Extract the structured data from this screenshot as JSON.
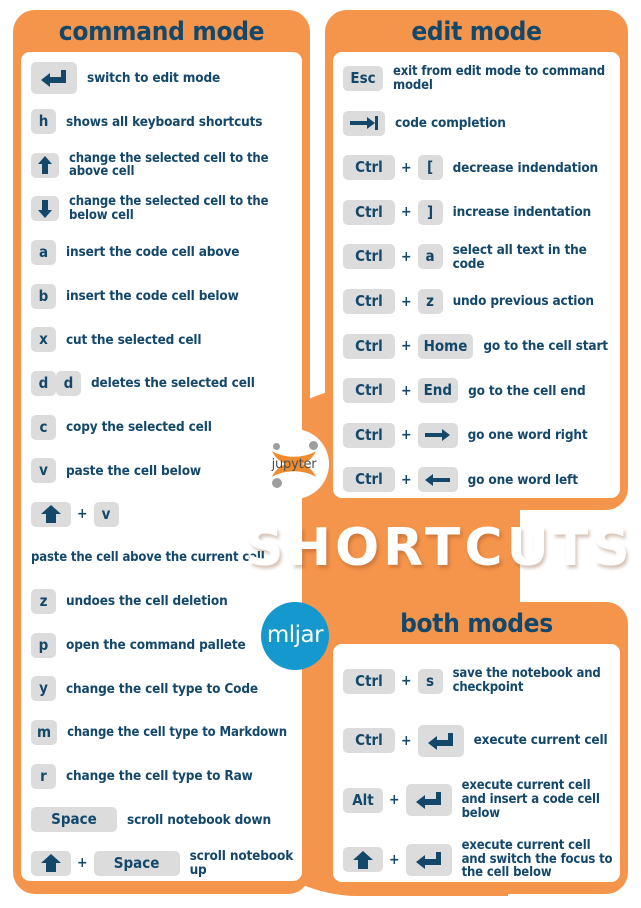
{
  "title": "SHORTCUTS",
  "colors": {
    "orange": "#F5944B",
    "navy": "#13486B",
    "key_gray": "#DCDCDC",
    "mljar_blue": "#1498CD",
    "white": "#FFFFFF"
  },
  "logos": {
    "jupyter": "jupyter",
    "mljar": "mljar"
  },
  "panels": {
    "command": {
      "title": "command mode",
      "rows": [
        {
          "keys": [
            {
              "type": "icon",
              "icon": "enter-key-icon",
              "size": "big"
            }
          ],
          "desc": "switch to edit mode"
        },
        {
          "keys": [
            {
              "type": "text",
              "label": "h"
            }
          ],
          "desc": "shows all keyboard shortcuts"
        },
        {
          "keys": [
            {
              "type": "icon",
              "icon": "arrow-up-icon"
            }
          ],
          "desc": "change the selected cell to the above cell"
        },
        {
          "keys": [
            {
              "type": "icon",
              "icon": "arrow-down-icon"
            }
          ],
          "desc": "change the selected cell to the below cell"
        },
        {
          "keys": [
            {
              "type": "text",
              "label": "a"
            }
          ],
          "desc": "insert the code cell above"
        },
        {
          "keys": [
            {
              "type": "text",
              "label": "b"
            }
          ],
          "desc": "insert the code cell below"
        },
        {
          "keys": [
            {
              "type": "text",
              "label": "x"
            }
          ],
          "desc": "cut the selected cell"
        },
        {
          "keys": [
            {
              "type": "text",
              "label": "d"
            },
            {
              "type": "text",
              "label": "d"
            }
          ],
          "desc": "deletes the selected cell"
        },
        {
          "keys": [
            {
              "type": "text",
              "label": "c"
            }
          ],
          "desc": "copy the selected cell"
        },
        {
          "keys": [
            {
              "type": "text",
              "label": "v"
            }
          ],
          "desc": "paste the cell below"
        },
        {
          "keys": [
            {
              "type": "icon",
              "icon": "shift-arrow-up-icon",
              "size": "wide"
            },
            {
              "type": "plus",
              "label": "+"
            },
            {
              "type": "text",
              "label": "v"
            }
          ],
          "desc": ""
        },
        {
          "keys": [],
          "desc": "paste the cell above the current cell"
        },
        {
          "keys": [
            {
              "type": "text",
              "label": "z"
            }
          ],
          "desc": "undoes the cell deletion"
        },
        {
          "keys": [
            {
              "type": "text",
              "label": "p"
            }
          ],
          "desc": "open the command pallete"
        },
        {
          "keys": [
            {
              "type": "text",
              "label": "y"
            }
          ],
          "desc": "change the cell type to Code"
        },
        {
          "keys": [
            {
              "type": "text",
              "label": "m"
            }
          ],
          "desc": "change the cell type to Markdown"
        },
        {
          "keys": [
            {
              "type": "text",
              "label": "r"
            }
          ],
          "desc": "change the cell type to Raw"
        },
        {
          "keys": [
            {
              "type": "text",
              "label": "Space",
              "size": "space"
            }
          ],
          "desc": "scroll notebook down"
        },
        {
          "keys": [
            {
              "type": "icon",
              "icon": "shift-arrow-up-icon",
              "size": "wide"
            },
            {
              "type": "plus",
              "label": "+"
            },
            {
              "type": "text",
              "label": "Space",
              "size": "space"
            }
          ],
          "desc": "scroll notebook up"
        }
      ]
    },
    "edit": {
      "title": "edit mode",
      "rows": [
        {
          "keys": [
            {
              "type": "text",
              "label": "Esc",
              "size": "wide"
            }
          ],
          "desc": "exit from edit mode to command model"
        },
        {
          "keys": [
            {
              "type": "icon",
              "icon": "tab-key-icon",
              "size": "wide"
            }
          ],
          "desc": "code completion"
        },
        {
          "keys": [
            {
              "type": "text",
              "label": "Ctrl",
              "size": "wider"
            },
            {
              "type": "plus",
              "label": "+"
            },
            {
              "type": "text",
              "label": "["
            }
          ],
          "desc": "decrease indendation"
        },
        {
          "keys": [
            {
              "type": "text",
              "label": "Ctrl",
              "size": "wider"
            },
            {
              "type": "plus",
              "label": "+"
            },
            {
              "type": "text",
              "label": "]"
            }
          ],
          "desc": "increase indentation"
        },
        {
          "keys": [
            {
              "type": "text",
              "label": "Ctrl",
              "size": "wider"
            },
            {
              "type": "plus",
              "label": "+"
            },
            {
              "type": "text",
              "label": "a"
            }
          ],
          "desc": "select all text in the code"
        },
        {
          "keys": [
            {
              "type": "text",
              "label": "Ctrl",
              "size": "wider"
            },
            {
              "type": "plus",
              "label": "+"
            },
            {
              "type": "text",
              "label": "z"
            }
          ],
          "desc": "undo previous action"
        },
        {
          "keys": [
            {
              "type": "text",
              "label": "Ctrl",
              "size": "wider"
            },
            {
              "type": "plus",
              "label": "+"
            },
            {
              "type": "text",
              "label": "Home",
              "size": "wider"
            }
          ],
          "desc": "go to the cell start"
        },
        {
          "keys": [
            {
              "type": "text",
              "label": "Ctrl",
              "size": "wider"
            },
            {
              "type": "plus",
              "label": "+"
            },
            {
              "type": "text",
              "label": "End",
              "size": "wide"
            }
          ],
          "desc": "go to the cell end"
        },
        {
          "keys": [
            {
              "type": "text",
              "label": "Ctrl",
              "size": "wider"
            },
            {
              "type": "plus",
              "label": "+"
            },
            {
              "type": "icon",
              "icon": "arrow-right-icon",
              "size": "wide"
            }
          ],
          "desc": "go one word right"
        },
        {
          "keys": [
            {
              "type": "text",
              "label": "Ctrl",
              "size": "wider"
            },
            {
              "type": "plus",
              "label": "+"
            },
            {
              "type": "icon",
              "icon": "arrow-left-icon",
              "size": "wide"
            }
          ],
          "desc": "go one word left"
        }
      ]
    },
    "both": {
      "title": "both modes",
      "rows": [
        {
          "keys": [
            {
              "type": "text",
              "label": "Ctrl",
              "size": "wider"
            },
            {
              "type": "plus",
              "label": "+"
            },
            {
              "type": "text",
              "label": "s"
            }
          ],
          "desc": "save the notebook and checkpoint"
        },
        {
          "keys": [
            {
              "type": "text",
              "label": "Ctrl",
              "size": "wider"
            },
            {
              "type": "plus",
              "label": "+"
            },
            {
              "type": "icon",
              "icon": "enter-key-icon",
              "size": "big"
            }
          ],
          "desc": "execute current cell"
        },
        {
          "keys": [
            {
              "type": "text",
              "label": "Alt",
              "size": "wide"
            },
            {
              "type": "plus",
              "label": "+"
            },
            {
              "type": "icon",
              "icon": "enter-key-icon",
              "size": "big"
            }
          ],
          "desc": "execute current cell and insert a code cell below"
        },
        {
          "keys": [
            {
              "type": "icon",
              "icon": "shift-arrow-up-icon",
              "size": "wide"
            },
            {
              "type": "plus",
              "label": "+"
            },
            {
              "type": "icon",
              "icon": "enter-key-icon",
              "size": "big"
            }
          ],
          "desc": "execute current cell and switch the focus to the cell below"
        }
      ]
    }
  }
}
